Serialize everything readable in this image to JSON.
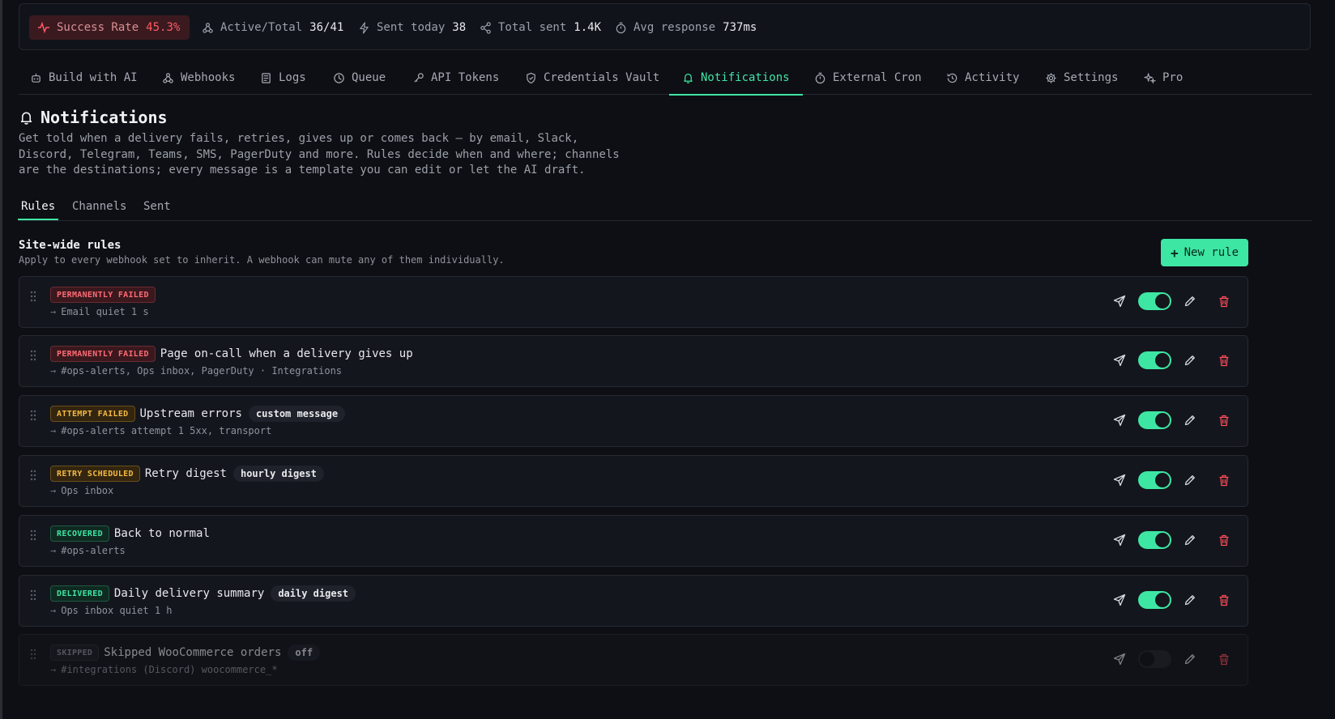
{
  "stats": {
    "success_label": "Success Rate",
    "success_value": "45.3%",
    "active_label": "Active/Total",
    "active_value": "36/41",
    "sent_today_label": "Sent today",
    "sent_today_value": "38",
    "total_sent_label": "Total sent",
    "total_sent_value": "1.4K",
    "avg_response_label": "Avg response",
    "avg_response_value": "737ms"
  },
  "nav": {
    "tabs": [
      {
        "label": "Build with AI",
        "icon": "robot-icon"
      },
      {
        "label": "Webhooks",
        "icon": "webhook-icon"
      },
      {
        "label": "Logs",
        "icon": "scroll-icon"
      },
      {
        "label": "Queue",
        "icon": "clock-icon"
      },
      {
        "label": "API Tokens",
        "icon": "key-icon"
      },
      {
        "label": "Credentials Vault",
        "icon": "shield-icon"
      },
      {
        "label": "Notifications",
        "icon": "bell-icon",
        "active": true
      },
      {
        "label": "External Cron",
        "icon": "timer-icon"
      },
      {
        "label": "Activity",
        "icon": "history-icon"
      },
      {
        "label": "Settings",
        "icon": "gear-icon"
      },
      {
        "label": "Pro",
        "icon": "sparkles-icon"
      }
    ]
  },
  "page": {
    "title": "Notifications",
    "description_lines": [
      "Get told when a delivery fails, retries, gives up or comes back — by email, Slack,",
      "Discord, Telegram, Teams, SMS, PagerDuty and more. Rules decide when and where; channels",
      "are the destinations; every message is a template you can edit or let the AI draft."
    ]
  },
  "subtabs": [
    "Rules",
    "Channels",
    "Sent"
  ],
  "section": {
    "title": "Site-wide rules",
    "subtitle": "Apply to every webhook set to inherit. A webhook can mute any of them individually.",
    "new_rule_label": "New rule"
  },
  "rules": [
    {
      "badge": "PERMANENTLY FAILED",
      "badge_color": "#ff6b75",
      "name": "",
      "pill": "",
      "targets": "Email  quiet 1 s",
      "enabled": true
    },
    {
      "badge": "PERMANENTLY FAILED",
      "badge_color": "#ff6b75",
      "name": "Page on-call when a delivery gives up",
      "pill": "",
      "targets": "#ops-alerts, Ops inbox, PagerDuty · Integrations",
      "enabled": true
    },
    {
      "badge": "ATTEMPT FAILED",
      "badge_color": "#f4b942",
      "name": "Upstream errors",
      "pill": "custom message",
      "targets": "#ops-alerts  attempt 1  5xx, transport",
      "enabled": true
    },
    {
      "badge": "RETRY SCHEDULED",
      "badge_color": "#f4b942",
      "name": "Retry digest",
      "pill": "hourly digest",
      "targets": "Ops inbox",
      "enabled": true
    },
    {
      "badge": "RECOVERED",
      "badge_color": "#3ee6a4",
      "name": "Back to normal",
      "pill": "",
      "targets": "#ops-alerts",
      "enabled": true
    },
    {
      "badge": "DELIVERED",
      "badge_color": "#3ee6a4",
      "name": "Daily delivery summary",
      "pill": "daily digest",
      "targets": "Ops inbox  quiet 1 h",
      "enabled": true
    },
    {
      "badge": "SKIPPED",
      "badge_color": "#8a8f99",
      "name": "Skipped WooCommerce orders",
      "pill": "off",
      "targets": "#integrations (Discord)  woocommerce_*",
      "enabled": false
    }
  ],
  "accent_color": "#3ee6a4",
  "danger_color": "#ff4d5a"
}
